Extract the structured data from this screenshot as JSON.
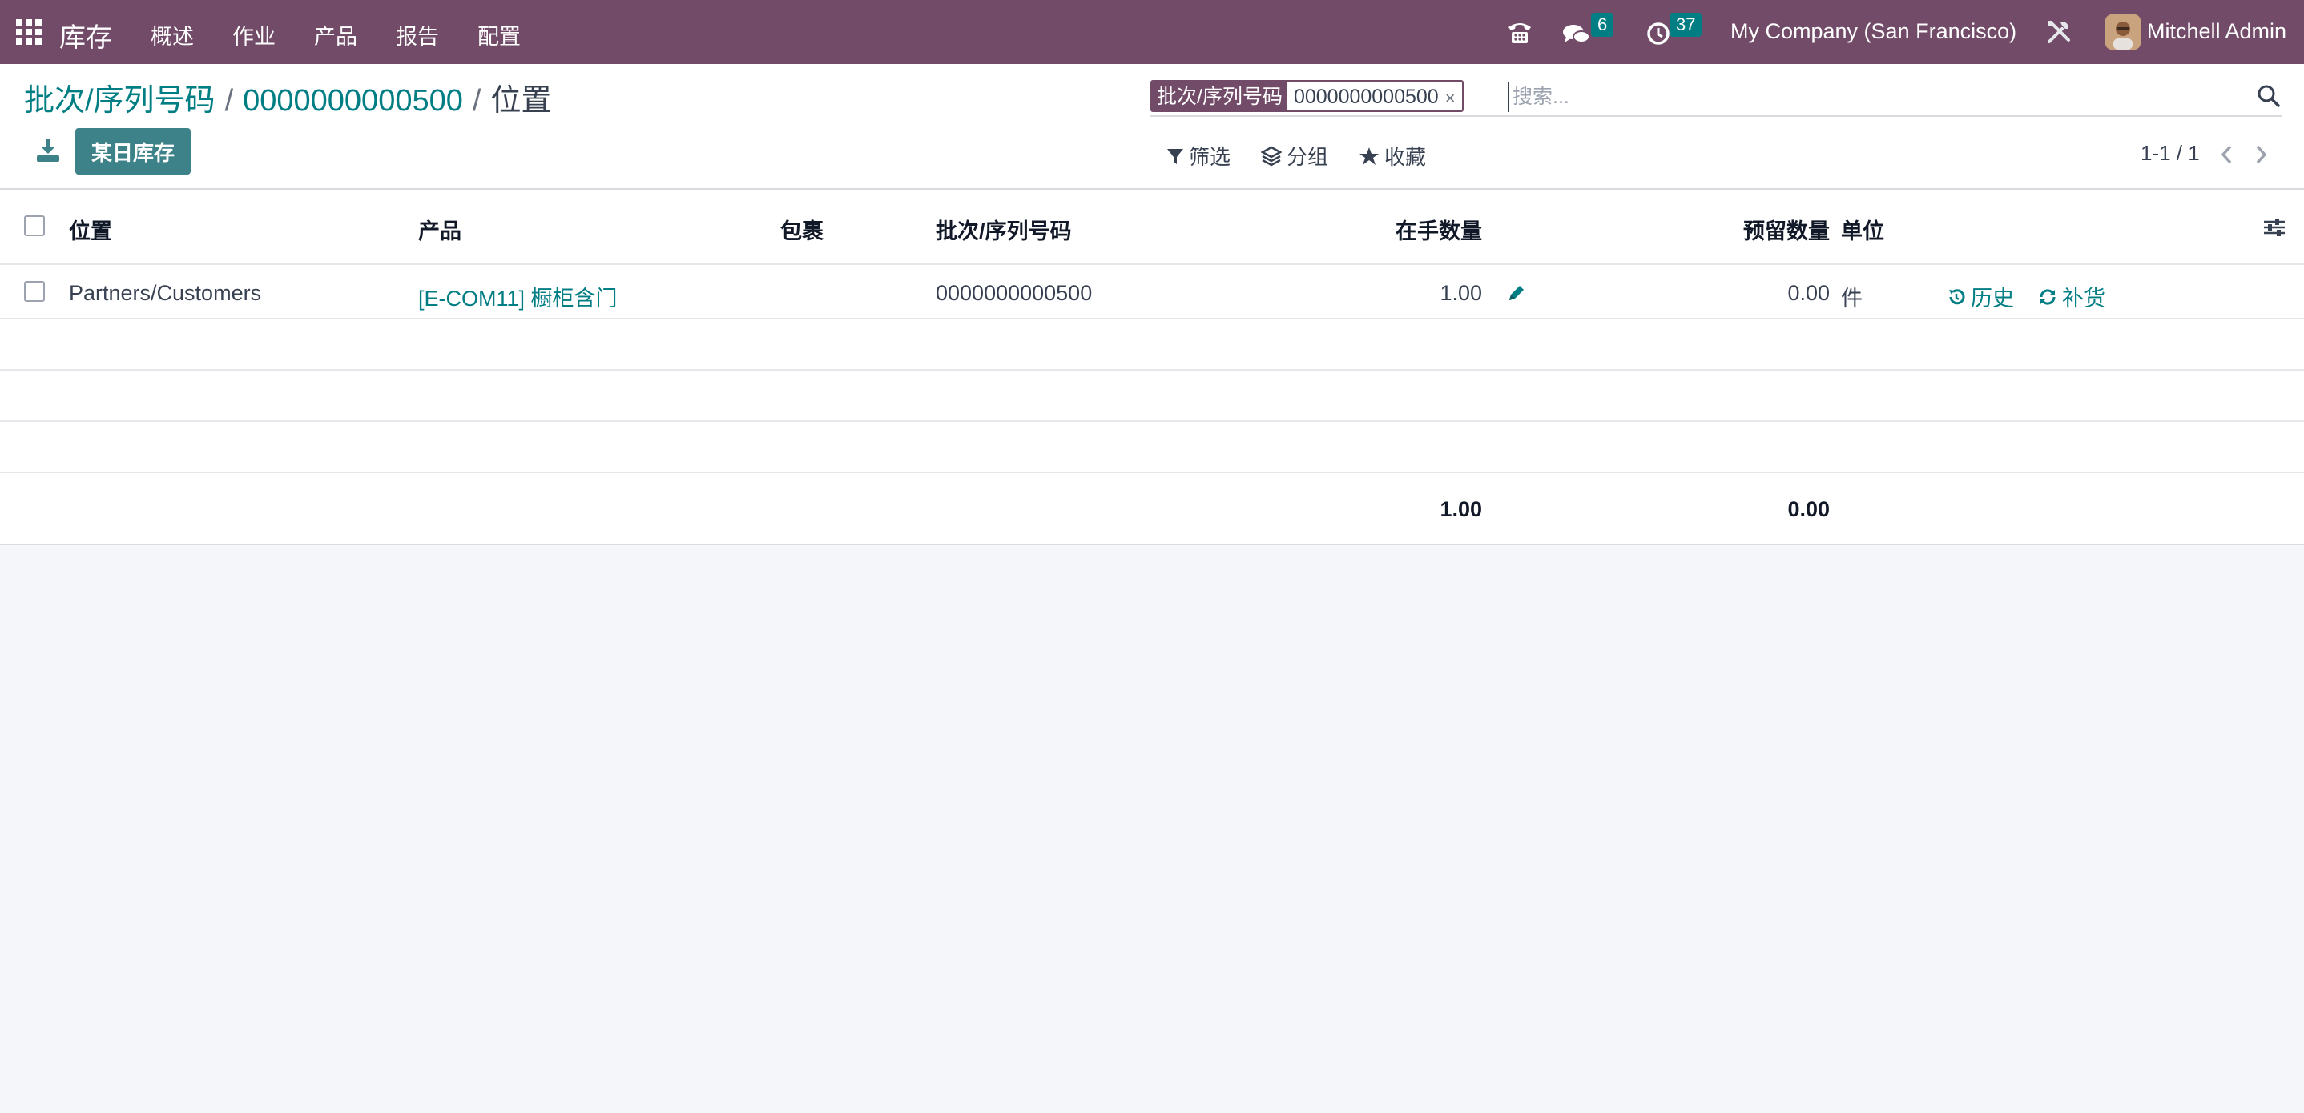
{
  "navbar": {
    "app_name": "库存",
    "menu": [
      "概述",
      "作业",
      "产品",
      "报告",
      "配置"
    ],
    "messages_count": "6",
    "activities_count": "37",
    "company": "My Company (San Francisco)",
    "user": "Mitchell Admin"
  },
  "breadcrumb": {
    "items": [
      "批次/序列号码",
      "0000000000500"
    ],
    "current": "位置"
  },
  "toolbar": {
    "primary_button": "某日库存"
  },
  "search": {
    "facet_label": "批次/序列号码",
    "facet_value": "0000000000500",
    "facet_close": "×",
    "placeholder": "搜索..."
  },
  "search_options": {
    "filter": "筛选",
    "group_by": "分组",
    "favorites": "收藏"
  },
  "pager": {
    "value": "1-1 / 1"
  },
  "table": {
    "headers": {
      "location": "位置",
      "product": "产品",
      "package": "包裹",
      "lot": "批次/序列号码",
      "on_hand": "在手数量",
      "reserved": "预留数量",
      "uom": "单位"
    },
    "rows": [
      {
        "location": "Partners/Customers",
        "product": "[E-COM11] 橱柜含门",
        "package": "",
        "lot": "0000000000500",
        "on_hand": "1.00",
        "reserved": "0.00",
        "uom": "件",
        "history_label": "历史",
        "replenish_label": "补货"
      }
    ],
    "footer": {
      "on_hand_total": "1.00",
      "reserved_total": "0.00"
    }
  },
  "icons": {
    "apps": "apps-grid-icon",
    "phone": "phone-icon",
    "chat": "chat-icon",
    "activity": "clock-icon",
    "settings": "tools-icon",
    "download": "download-icon",
    "search": "search-icon",
    "filter": "filter-icon",
    "layers": "layers-icon",
    "star": "star-icon",
    "edit": "pencil-icon",
    "history": "history-icon",
    "refresh": "refresh-icon",
    "optional_columns": "sliders-icon"
  },
  "colors": {
    "navbar": "#714b67",
    "accent": "#017e84",
    "primary_button": "#3d8189"
  }
}
